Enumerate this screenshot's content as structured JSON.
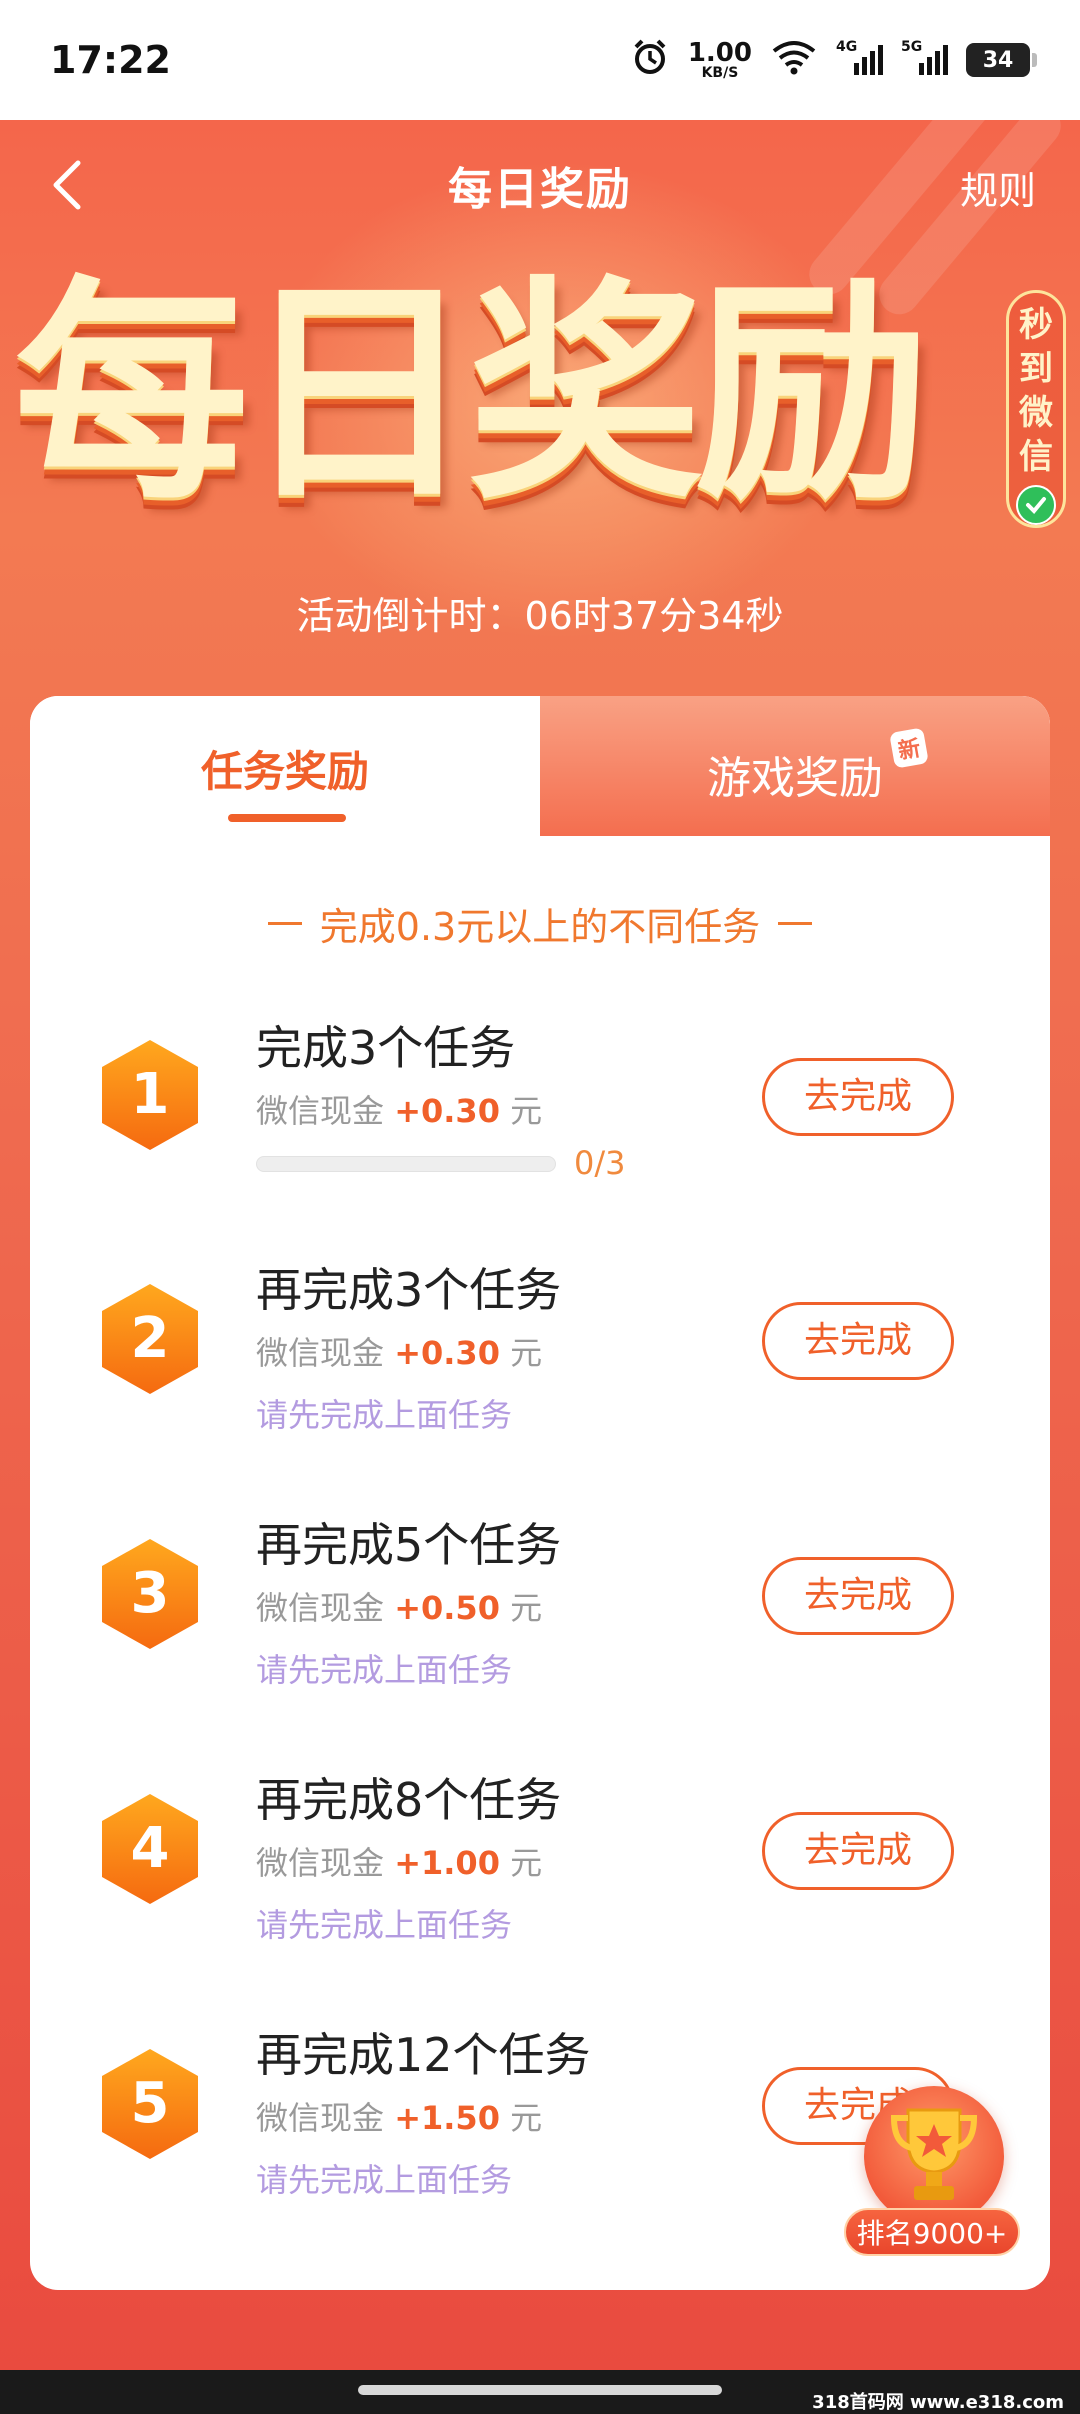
{
  "status_bar": {
    "time": "17:22",
    "speed_value": "1.00",
    "speed_unit": "KB/S",
    "signal_1_label": "4G",
    "signal_2_label": "5G",
    "battery": "34"
  },
  "nav": {
    "title": "每日奖励",
    "rules_label": "规则"
  },
  "hero": {
    "big_title": "每日奖励",
    "badge_chars": [
      "秒",
      "到",
      "微",
      "信"
    ],
    "countdown": "活动倒计时：06时37分34秒"
  },
  "tabs": [
    {
      "label": "任务奖励",
      "active": true
    },
    {
      "label": "游戏奖励",
      "active": false,
      "badge": "新"
    }
  ],
  "subtitle": "完成0.3元以上的不同任务",
  "tasks": [
    {
      "num": "1",
      "title": "完成3个任务",
      "reward_prefix": "微信现金",
      "amount": "+0.30",
      "unit": "元",
      "progress_text": "0/3",
      "progress": 0,
      "button": "去完成"
    },
    {
      "num": "2",
      "title": "再完成3个任务",
      "reward_prefix": "微信现金",
      "amount": "+0.30",
      "unit": "元",
      "hint": "请先完成上面任务",
      "button": "去完成"
    },
    {
      "num": "3",
      "title": "再完成5个任务",
      "reward_prefix": "微信现金",
      "amount": "+0.50",
      "unit": "元",
      "hint": "请先完成上面任务",
      "button": "去完成"
    },
    {
      "num": "4",
      "title": "再完成8个任务",
      "reward_prefix": "微信现金",
      "amount": "+1.00",
      "unit": "元",
      "hint": "请先完成上面任务",
      "button": "去完成"
    },
    {
      "num": "5",
      "title": "再完成12个任务",
      "reward_prefix": "微信现金",
      "amount": "+1.50",
      "unit": "元",
      "hint": "请先完成上面任务",
      "button": "去完成"
    }
  ],
  "rank": {
    "label": "排名9000+"
  },
  "watermark": "318首码网 www.e318.com",
  "colors": {
    "accent": "#f0602a",
    "hero_top": "#f4664b",
    "hint_purple": "#b39be0",
    "title_gold": "#fff3c9"
  }
}
